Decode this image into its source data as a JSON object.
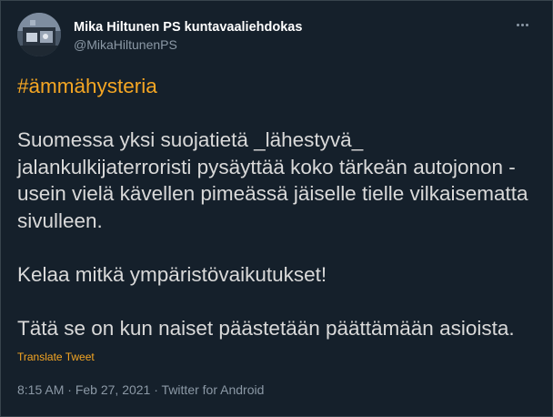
{
  "author": {
    "display_name": "Mika Hiltunen PS kuntavaaliehdokas",
    "handle": "@MikaHiltunenPS",
    "avatar_icon": "profile-photo"
  },
  "more_icon": "more-horizontal-icon",
  "tweet": {
    "hashtag": "#ämmähysteria",
    "paragraph_1": "Suomessa yksi suojatietä _lähestyvä_ jalankulkijaterroristi pysäyttää koko tärkeän autojonon - usein vielä kävellen pimeässä jäiselle tielle vilkaisematta sivulleen.",
    "paragraph_2": "Kelaa mitkä ympäristövaikutukset!",
    "paragraph_3": "Tätä se on kun naiset päästetään päättämään asioista."
  },
  "translate_label": "Translate Tweet",
  "meta": {
    "time": "8:15 AM",
    "separator": " · ",
    "date": "Feb 27, 2021",
    "source": "Twitter for Android"
  },
  "colors": {
    "background": "#15202b",
    "text": "#d9d9d9",
    "accent": "#f5a623",
    "secondary_text": "#8b98a5",
    "border": "#38444d"
  }
}
